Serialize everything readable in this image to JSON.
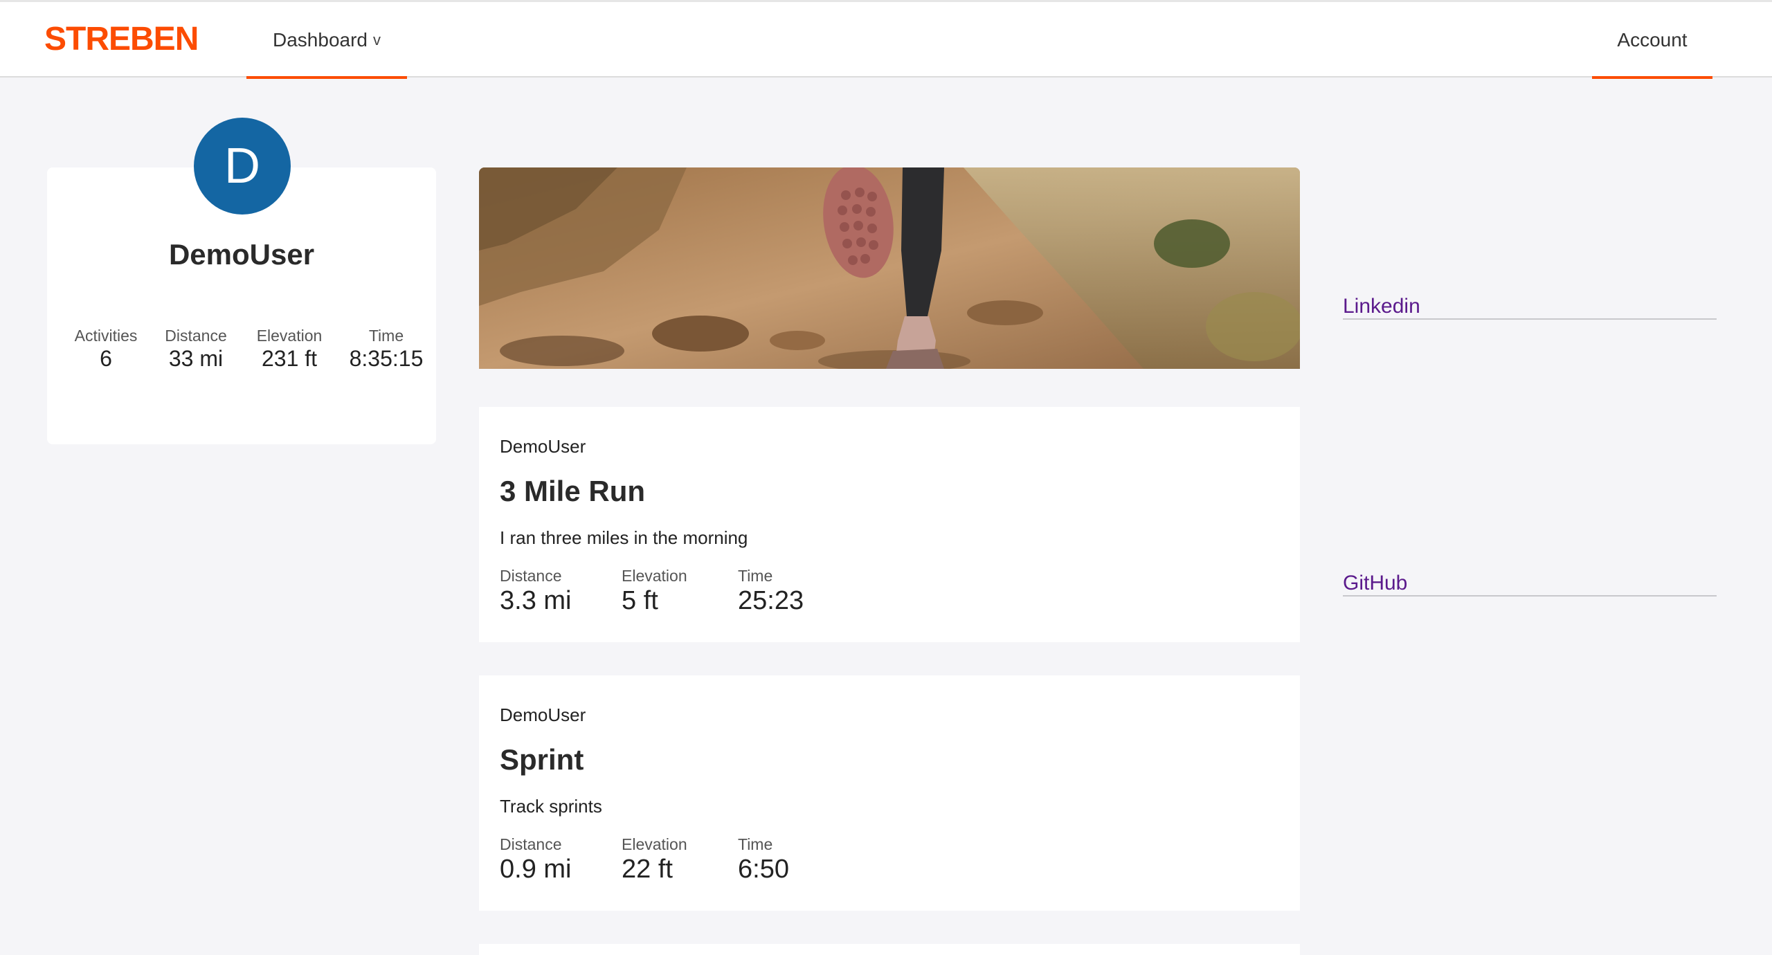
{
  "header": {
    "brand": "STREBEN",
    "nav_dashboard": "Dashboard",
    "nav_dashboard_chevron": "v",
    "nav_account": "Account",
    "accent_color": "#fc4c02"
  },
  "profile": {
    "avatar_letter": "D",
    "avatar_color": "#1466a3",
    "name": "DemoUser",
    "stats": [
      {
        "label": "Activities",
        "value": "6"
      },
      {
        "label": "Distance",
        "value": "33 mi"
      },
      {
        "label": "Elevation",
        "value": "231 ft"
      },
      {
        "label": "Time",
        "value": "8:35:15"
      }
    ]
  },
  "activities": [
    {
      "user": "DemoUser",
      "title": "3 Mile Run",
      "description": "I ran three miles in the morning",
      "stats": [
        {
          "label": "Distance",
          "value": "3.3 mi"
        },
        {
          "label": "Elevation",
          "value": "5 ft"
        },
        {
          "label": "Time",
          "value": "25:23"
        }
      ]
    },
    {
      "user": "DemoUser",
      "title": "Sprint",
      "description": "Track sprints",
      "stats": [
        {
          "label": "Distance",
          "value": "0.9 mi"
        },
        {
          "label": "Elevation",
          "value": "22 ft"
        },
        {
          "label": "Time",
          "value": "6:50"
        }
      ]
    }
  ],
  "side_links": {
    "linkedin": "Linkedin",
    "github": "GitHub"
  }
}
